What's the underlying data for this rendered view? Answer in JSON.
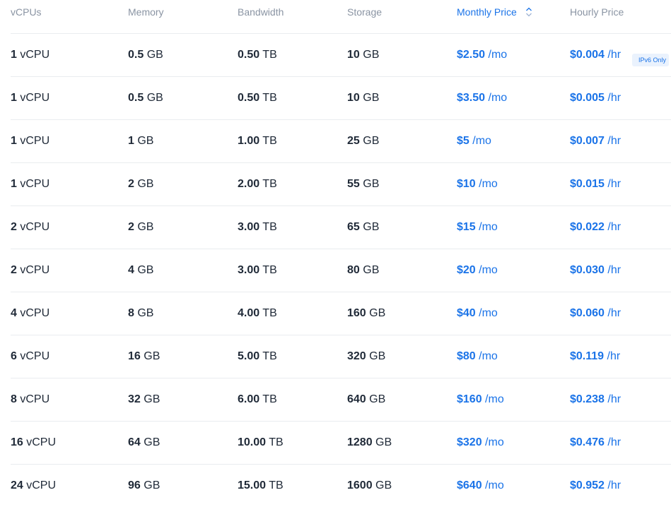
{
  "headers": {
    "vcpus": "vCPUs",
    "memory": "Memory",
    "bandwidth": "Bandwidth",
    "storage": "Storage",
    "monthly": "Monthly Price",
    "hourly": "Hourly Price"
  },
  "sort": {
    "column": "monthly",
    "icon": "sort-icon"
  },
  "colors": {
    "accent": "#1a73e8",
    "header": "#8a94a3",
    "text": "#1f2937",
    "divider": "#e9ecef"
  },
  "units": {
    "vcpu": "vCPU",
    "memory": "GB",
    "bandwidth": "TB",
    "storage": "GB",
    "monthly": "/mo",
    "hourly": "/hr"
  },
  "rows": [
    {
      "vcpu": "1",
      "memory": "0.5",
      "bandwidth": "0.50",
      "storage": "10",
      "monthly": "$2.50",
      "hourly": "$0.004",
      "badge": "IPv6 Only"
    },
    {
      "vcpu": "1",
      "memory": "0.5",
      "bandwidth": "0.50",
      "storage": "10",
      "monthly": "$3.50",
      "hourly": "$0.005"
    },
    {
      "vcpu": "1",
      "memory": "1",
      "bandwidth": "1.00",
      "storage": "25",
      "monthly": "$5",
      "hourly": "$0.007"
    },
    {
      "vcpu": "1",
      "memory": "2",
      "bandwidth": "2.00",
      "storage": "55",
      "monthly": "$10",
      "hourly": "$0.015"
    },
    {
      "vcpu": "2",
      "memory": "2",
      "bandwidth": "3.00",
      "storage": "65",
      "monthly": "$15",
      "hourly": "$0.022"
    },
    {
      "vcpu": "2",
      "memory": "4",
      "bandwidth": "3.00",
      "storage": "80",
      "monthly": "$20",
      "hourly": "$0.030"
    },
    {
      "vcpu": "4",
      "memory": "8",
      "bandwidth": "4.00",
      "storage": "160",
      "monthly": "$40",
      "hourly": "$0.060"
    },
    {
      "vcpu": "6",
      "memory": "16",
      "bandwidth": "5.00",
      "storage": "320",
      "monthly": "$80",
      "hourly": "$0.119"
    },
    {
      "vcpu": "8",
      "memory": "32",
      "bandwidth": "6.00",
      "storage": "640",
      "monthly": "$160",
      "hourly": "$0.238"
    },
    {
      "vcpu": "16",
      "memory": "64",
      "bandwidth": "10.00",
      "storage": "1280",
      "monthly": "$320",
      "hourly": "$0.476"
    },
    {
      "vcpu": "24",
      "memory": "96",
      "bandwidth": "15.00",
      "storage": "1600",
      "monthly": "$640",
      "hourly": "$0.952"
    }
  ]
}
